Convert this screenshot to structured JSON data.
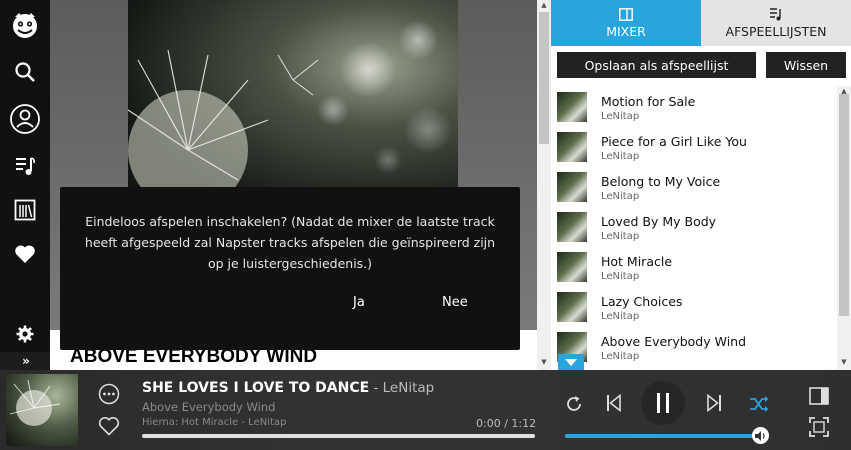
{
  "sidebar": {
    "items": [
      {
        "icon": "napster-logo-icon"
      },
      {
        "icon": "search-icon"
      },
      {
        "icon": "user-icon"
      },
      {
        "icon": "music-list-icon"
      },
      {
        "icon": "library-icon"
      },
      {
        "icon": "heart-icon"
      },
      {
        "icon": "gear-icon"
      }
    ],
    "expand_label": "»"
  },
  "main": {
    "album_title": "ABOVE EVERYBODY WIND"
  },
  "dialog": {
    "message": "Eindeloos afspelen inschakelen? (Nadat de mixer de laatste track heeft afgespeeld zal Napster tracks afspelen die geïnspireerd zijn op je luistergeschiedenis.)",
    "yes_label": "Ja",
    "no_label": "Nee"
  },
  "right_panel": {
    "tabs": [
      {
        "label": "MIXER",
        "active": true
      },
      {
        "label": "AFSPEELLIJSTEN",
        "active": false
      }
    ],
    "save_label": "Opslaan als afspeellijst",
    "clear_label": "Wissen",
    "tracks": [
      {
        "title": "Motion for Sale",
        "artist": "LeNitap"
      },
      {
        "title": "Piece for a Girl Like You",
        "artist": "LeNitap"
      },
      {
        "title": "Belong to My Voice",
        "artist": "LeNitap"
      },
      {
        "title": "Loved By My Body",
        "artist": "LeNitap"
      },
      {
        "title": "Hot Miracle",
        "artist": "LeNitap"
      },
      {
        "title": "Lazy Choices",
        "artist": "LeNitap"
      },
      {
        "title": "Above Everybody Wind",
        "artist": "LeNitap"
      }
    ]
  },
  "player": {
    "track_title": "SHE LOVES I LOVE TO DANCE",
    "artist_suffix": " - LeNitap",
    "album": "Above Everybody Wind",
    "next_up": "Hierna: Hot Miracle - LeNitap",
    "time": "0:00 / 1:12",
    "progress_percent": 0,
    "volume_percent": 100
  },
  "colors": {
    "accent": "#2aa4dc",
    "sidebar_bg": "#111111",
    "dialog_bg": "#111111",
    "player_bg": "#2f2f2f"
  }
}
